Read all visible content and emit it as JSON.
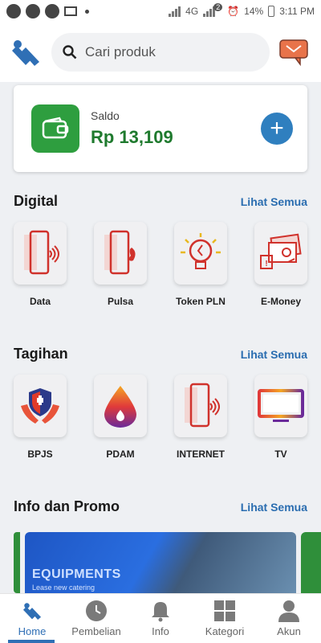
{
  "status_bar": {
    "network": "4G",
    "sim_badge": "2",
    "battery": "14%",
    "time": "3:11 PM"
  },
  "header": {
    "search_placeholder": "Cari produk"
  },
  "balance": {
    "label": "Saldo",
    "amount": "Rp 13,109"
  },
  "sections": {
    "digital": {
      "title": "Digital",
      "see_all": "Lihat Semua",
      "items": [
        {
          "label": "Data",
          "icon": "phone-signal-icon"
        },
        {
          "label": "Pulsa",
          "icon": "phone-call-icon"
        },
        {
          "label": "Token PLN",
          "icon": "lightbulb-icon"
        },
        {
          "label": "E-Money",
          "icon": "money-icon"
        }
      ]
    },
    "tagihan": {
      "title": "Tagihan",
      "see_all": "Lihat Semua",
      "items": [
        {
          "label": "BPJS",
          "icon": "shield-hands-icon"
        },
        {
          "label": "PDAM",
          "icon": "water-drop-icon"
        },
        {
          "label": "INTERNET",
          "icon": "phone-signal-icon"
        },
        {
          "label": "TV",
          "icon": "tv-icon"
        }
      ]
    },
    "promo": {
      "title": "Info dan Promo",
      "see_all": "Lihat Semua",
      "banner_title": "EQUIPMENTS",
      "banner_sub": "Lease new catering"
    }
  },
  "nav": [
    {
      "label": "Home",
      "icon": "home-logo-icon",
      "active": true
    },
    {
      "label": "Pembelian",
      "icon": "clock-icon",
      "active": false
    },
    {
      "label": "Info",
      "icon": "bell-icon",
      "active": false
    },
    {
      "label": "Kategori",
      "icon": "grid-icon",
      "active": false
    },
    {
      "label": "Akun",
      "icon": "person-icon",
      "active": false
    }
  ],
  "colors": {
    "primary_blue": "#2f6fb5",
    "brand_green": "#2e9e3f",
    "balance_green": "#1f7a2e",
    "link_blue": "#2a6db0"
  }
}
